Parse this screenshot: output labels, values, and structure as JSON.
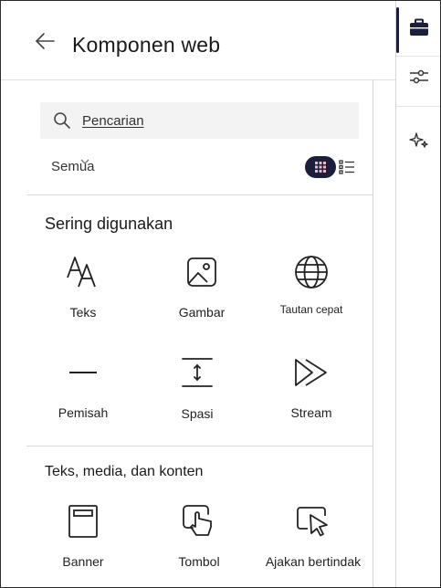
{
  "header": {
    "title": "Komponen web"
  },
  "search": {
    "placeholder": "Pencarian"
  },
  "filter": {
    "selected": "Semua"
  },
  "sections": [
    {
      "title": "Sering digunakan",
      "items": [
        {
          "label": "Teks",
          "icon": "text-icon"
        },
        {
          "label": "Gambar",
          "icon": "image-icon"
        },
        {
          "label": "Tautan cepat",
          "icon": "globe-icon"
        },
        {
          "label": "Pemisah",
          "icon": "divider-line-icon"
        },
        {
          "label": "Spasi",
          "icon": "spacer-icon"
        },
        {
          "label": "Stream",
          "icon": "stream-play-icon"
        }
      ]
    },
    {
      "title": "Teks, media, dan konten",
      "items": [
        {
          "label": "Banner",
          "icon": "banner-icon"
        },
        {
          "label": "Tombol",
          "icon": "button-tap-icon"
        },
        {
          "label": "Ajakan bertindak",
          "icon": "call-to-action-icon"
        }
      ]
    }
  ],
  "colors": {
    "accent": "#1b1f3a",
    "text": "#1f1f1f",
    "search_bg": "#f3f3f3"
  }
}
